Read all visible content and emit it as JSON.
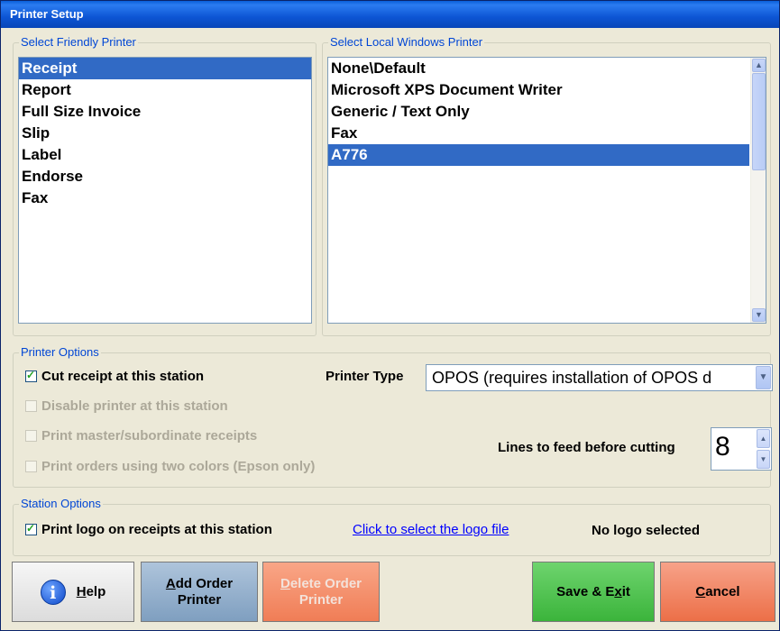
{
  "window": {
    "title": "Printer Setup"
  },
  "friendly": {
    "legend": "Select Friendly Printer",
    "items": [
      "Receipt",
      "Report",
      "Full Size Invoice",
      "Slip",
      "Label",
      "Endorse",
      "Fax"
    ],
    "selected": "Receipt"
  },
  "local": {
    "legend": "Select Local Windows Printer",
    "items": [
      "None\\Default",
      "Microsoft XPS Document Writer",
      "Generic / Text Only",
      "Fax",
      "A776"
    ],
    "selected": "A776"
  },
  "printer_options": {
    "legend": "Printer Options",
    "cut_receipt": {
      "label": "Cut receipt at this station",
      "checked": true,
      "enabled": true
    },
    "disable_printer": {
      "label": "Disable printer at this station",
      "checked": false,
      "enabled": false
    },
    "master_sub": {
      "label": "Print master/subordinate receipts",
      "checked": false,
      "enabled": false
    },
    "two_colors": {
      "label": "Print orders using two colors (Epson only)",
      "checked": false,
      "enabled": false
    },
    "printer_type_label": "Printer Type",
    "printer_type_value": "OPOS (requires installation of OPOS d",
    "lines_feed_label": "Lines to feed before cutting",
    "lines_feed_value": "8"
  },
  "station_options": {
    "legend": "Station Options",
    "print_logo": {
      "label": "Print logo on receipts at this station",
      "checked": true
    },
    "select_logo_link": "Click to select the logo file",
    "logo_status": "No logo selected"
  },
  "buttons": {
    "help": {
      "mnemonic": "H",
      "rest": "elp"
    },
    "add_order": {
      "mnemonic": "A",
      "line1_rest": "dd Order",
      "line2": "Printer"
    },
    "delete_order": {
      "mnemonic": "D",
      "line1_rest": "elete Order",
      "line2": "Printer"
    },
    "save_exit": {
      "before": "Save & E",
      "mnemonic": "x",
      "after": "it"
    },
    "cancel": {
      "mnemonic": "C",
      "rest": "ancel"
    }
  },
  "colors": {
    "selection": "#316ac5",
    "legend_text": "#0046d5",
    "link": "#0000ff"
  }
}
